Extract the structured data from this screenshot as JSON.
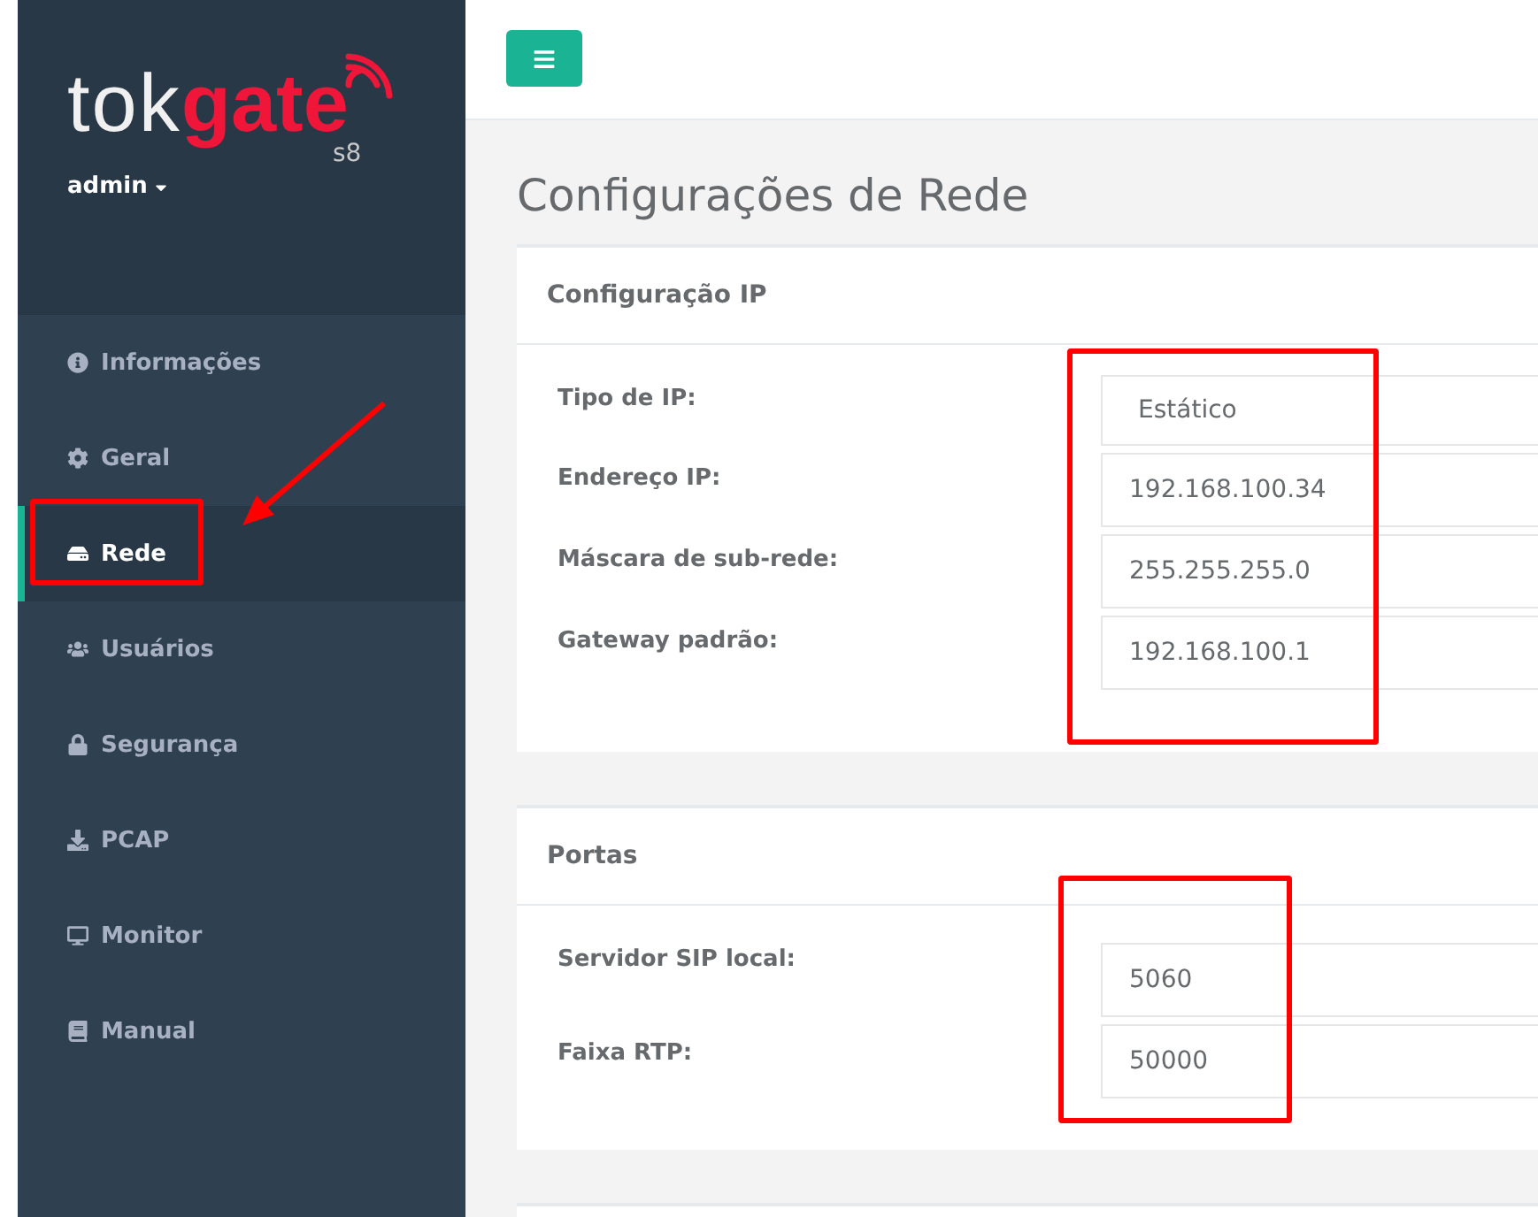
{
  "sidebar": {
    "logo": {
      "prefix": "tok",
      "accent": "gate",
      "model": "s8"
    },
    "user": {
      "name": "admin"
    },
    "items": [
      {
        "label": "Informações",
        "selected": false,
        "highlighted": false
      },
      {
        "label": "Geral",
        "selected": false,
        "highlighted": false
      },
      {
        "label": "Rede",
        "selected": true,
        "highlighted": true
      },
      {
        "label": "Usuários",
        "selected": false,
        "highlighted": false
      },
      {
        "label": "Segurança",
        "selected": false,
        "highlighted": false
      },
      {
        "label": "PCAP",
        "selected": false,
        "highlighted": false
      },
      {
        "label": "Monitor",
        "selected": false,
        "highlighted": false
      },
      {
        "label": "Manual",
        "selected": false,
        "highlighted": false
      }
    ]
  },
  "page": {
    "title": "Configurações de Rede"
  },
  "sections": [
    {
      "title": "Configuração IP",
      "highlighted": true,
      "fields": [
        {
          "label": "Tipo de IP:",
          "kind": "select",
          "value": "Estático"
        },
        {
          "label": "Endereço IP:",
          "kind": "text",
          "value": "192.168.100.34"
        },
        {
          "label": "Máscara de sub-rede:",
          "kind": "text",
          "value": "255.255.255.0"
        },
        {
          "label": "Gateway padrão:",
          "kind": "text",
          "value": "192.168.100.1"
        }
      ]
    },
    {
      "title": "Portas",
      "highlighted": true,
      "fields": [
        {
          "label": "Servidor SIP local:",
          "kind": "text",
          "value": "5060"
        },
        {
          "label": "Faixa RTP:",
          "kind": "text",
          "value": "50000"
        }
      ]
    }
  ]
}
